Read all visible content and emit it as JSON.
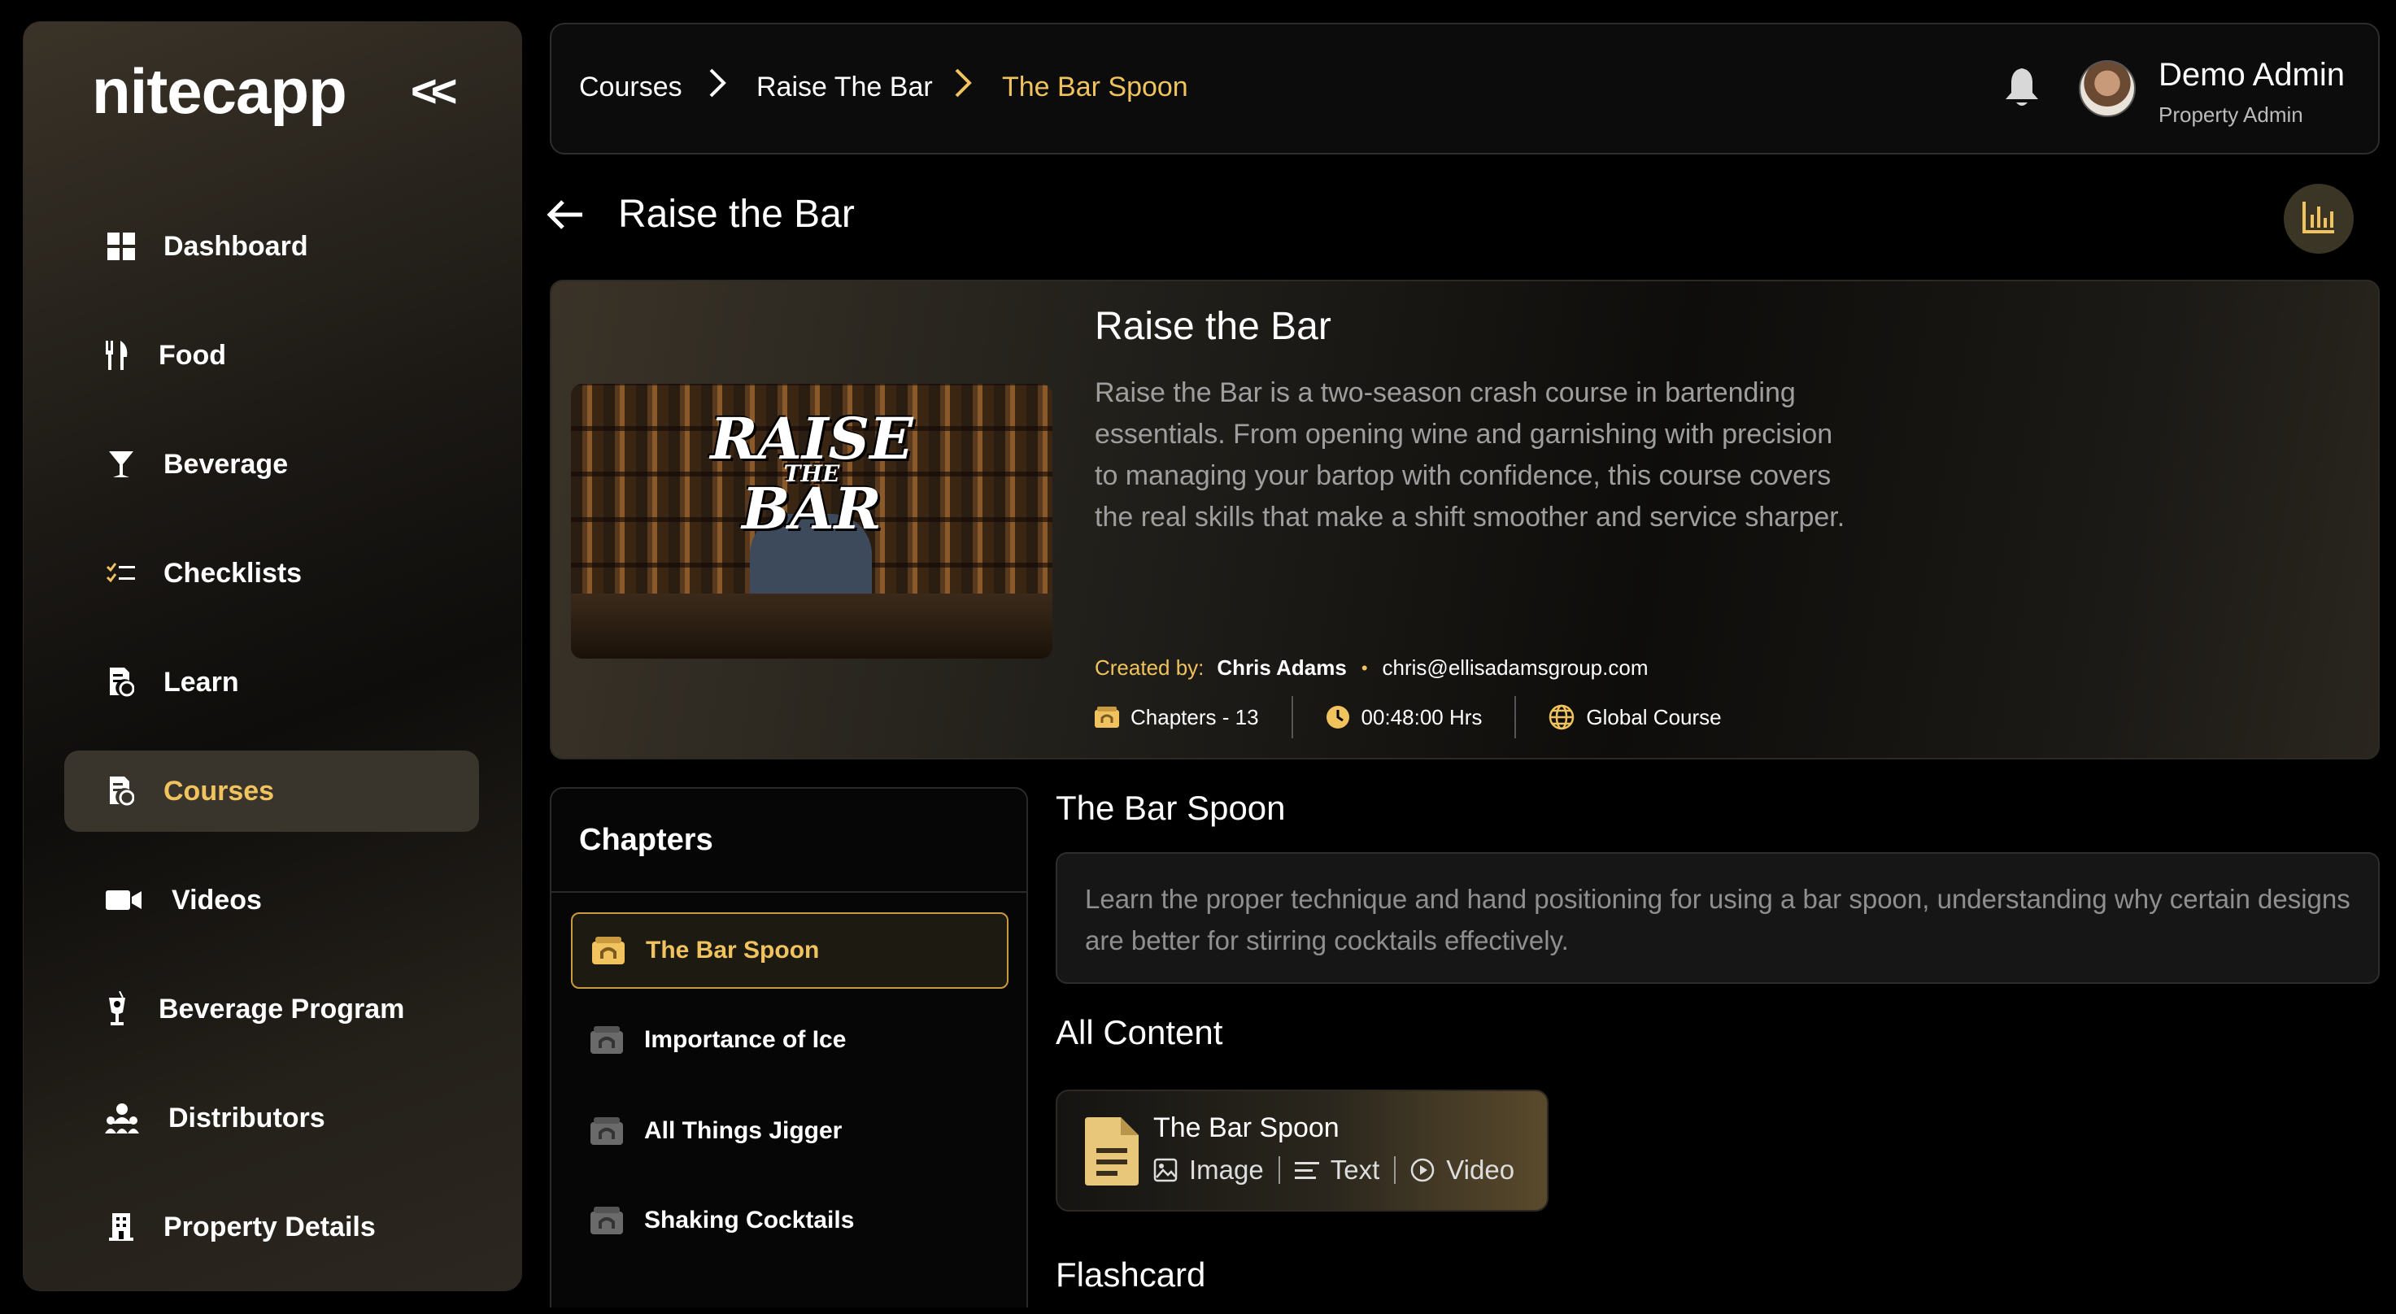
{
  "sidebar": {
    "logo": "nitecapp",
    "collapse": "<<",
    "items": [
      {
        "label": "Dashboard",
        "icon": "dashboard-grid-icon"
      },
      {
        "label": "Food",
        "icon": "fork-knife-icon"
      },
      {
        "label": "Beverage",
        "icon": "cocktail-glass-icon"
      },
      {
        "label": "Checklists",
        "icon": "checklist-icon"
      },
      {
        "label": "Learn",
        "icon": "learn-document-icon"
      },
      {
        "label": "Courses",
        "icon": "courses-document-icon"
      },
      {
        "label": "Videos",
        "icon": "video-camera-icon"
      },
      {
        "label": "Beverage Program",
        "icon": "beverage-program-icon"
      },
      {
        "label": "Distributors",
        "icon": "distributors-people-icon"
      },
      {
        "label": "Property Details",
        "icon": "building-icon"
      }
    ],
    "active_index": 5
  },
  "header": {
    "breadcrumbs": [
      "Courses",
      "Raise The Bar",
      "The Bar Spoon"
    ],
    "user_name": "Demo Admin",
    "user_role": "Property Admin"
  },
  "page": {
    "title": "Raise the Bar"
  },
  "course": {
    "title": "Raise the Bar",
    "description": "Raise the Bar is a two-season crash course in bartending essentials. From opening wine and garnishing with precision to managing your bartop with confidence, this course covers the real skills that make a shift smoother and service sharper.",
    "image_logo_top": "RAISE",
    "image_logo_mid": "THE",
    "image_logo_bottom": "BAR",
    "created_by_label": "Created by:",
    "creator_name": "Chris Adams",
    "creator_email": "chris@ellisadamsgroup.com",
    "chapters_count": "Chapters - 13",
    "duration": "00:48:00 Hrs",
    "scope": "Global Course"
  },
  "chapters": {
    "title": "Chapters",
    "items": [
      "The Bar Spoon",
      "Importance of Ice",
      "All Things Jigger",
      "Shaking Cocktails"
    ],
    "active_index": 0
  },
  "chapter_detail": {
    "title": "The Bar Spoon",
    "description": "Learn the proper technique and hand positioning for using a bar spoon, understanding why certain designs are better for stirring cocktails effectively."
  },
  "all_content": {
    "title": "All Content",
    "card_title": "The Bar Spoon",
    "tags": [
      "Image",
      "Text",
      "Video"
    ]
  },
  "flashcard": {
    "title": "Flashcard"
  },
  "colors": {
    "accent": "#f0c35f",
    "background": "#000000",
    "muted_text": "#9e9e9e"
  }
}
